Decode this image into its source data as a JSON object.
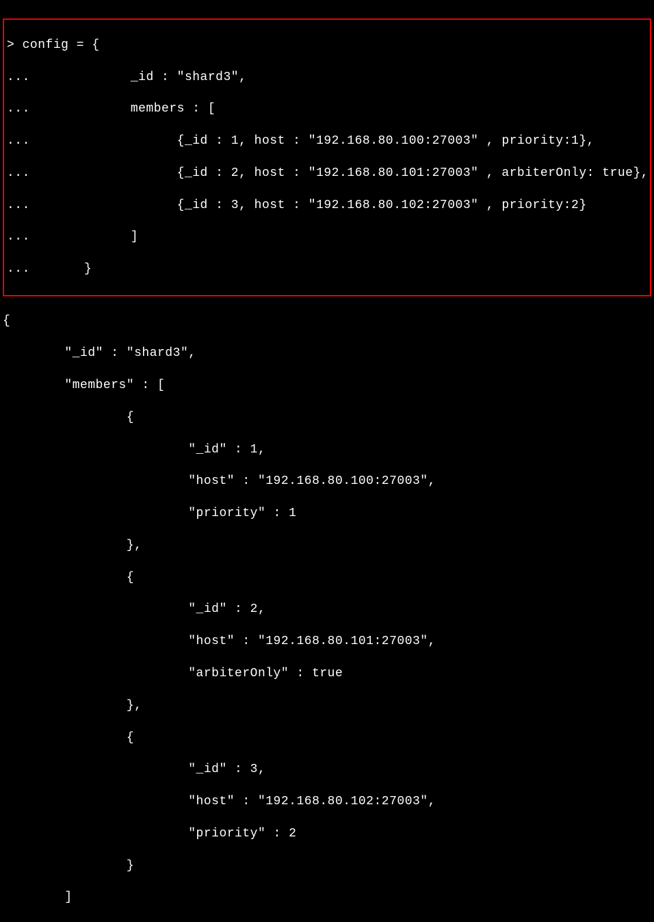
{
  "input": {
    "prompt": ">",
    "continuation": "...",
    "lines": [
      "config = {",
      "            _id : \"shard3\",",
      "            members : [",
      "                  {_id : 1, host : \"192.168.80.100:27003\" , priority:1},",
      "                  {_id : 2, host : \"192.168.80.101:27003\" , arbiterOnly: true},",
      "                  {_id : 3, host : \"192.168.80.102:27003\" , priority:2}",
      "            ]",
      "      }"
    ]
  },
  "output": {
    "lines": [
      "{",
      "        \"_id\" : \"shard3\",",
      "        \"members\" : [",
      "                {",
      "                        \"_id\" : 1,",
      "                        \"host\" : \"192.168.80.100:27003\",",
      "                        \"priority\" : 1",
      "                },",
      "                {",
      "                        \"_id\" : 2,",
      "                        \"host\" : \"192.168.80.101:27003\",",
      "                        \"arbiterOnly\" : true",
      "                },",
      "                {",
      "                        \"_id\" : 3,",
      "                        \"host\" : \"192.168.80.102:27003\",",
      "                        \"priority\" : 2",
      "                }",
      "        ]"
    ]
  },
  "chart_data": {
    "type": "table",
    "title": "MongoDB Replica Set Config shard3",
    "columns": [
      "_id",
      "host",
      "priority",
      "arbiterOnly"
    ],
    "rows": [
      [
        1,
        "192.168.80.100:27003",
        1,
        null
      ],
      [
        2,
        "192.168.80.101:27003",
        null,
        true
      ],
      [
        3,
        "192.168.80.102:27003",
        2,
        null
      ]
    ]
  }
}
